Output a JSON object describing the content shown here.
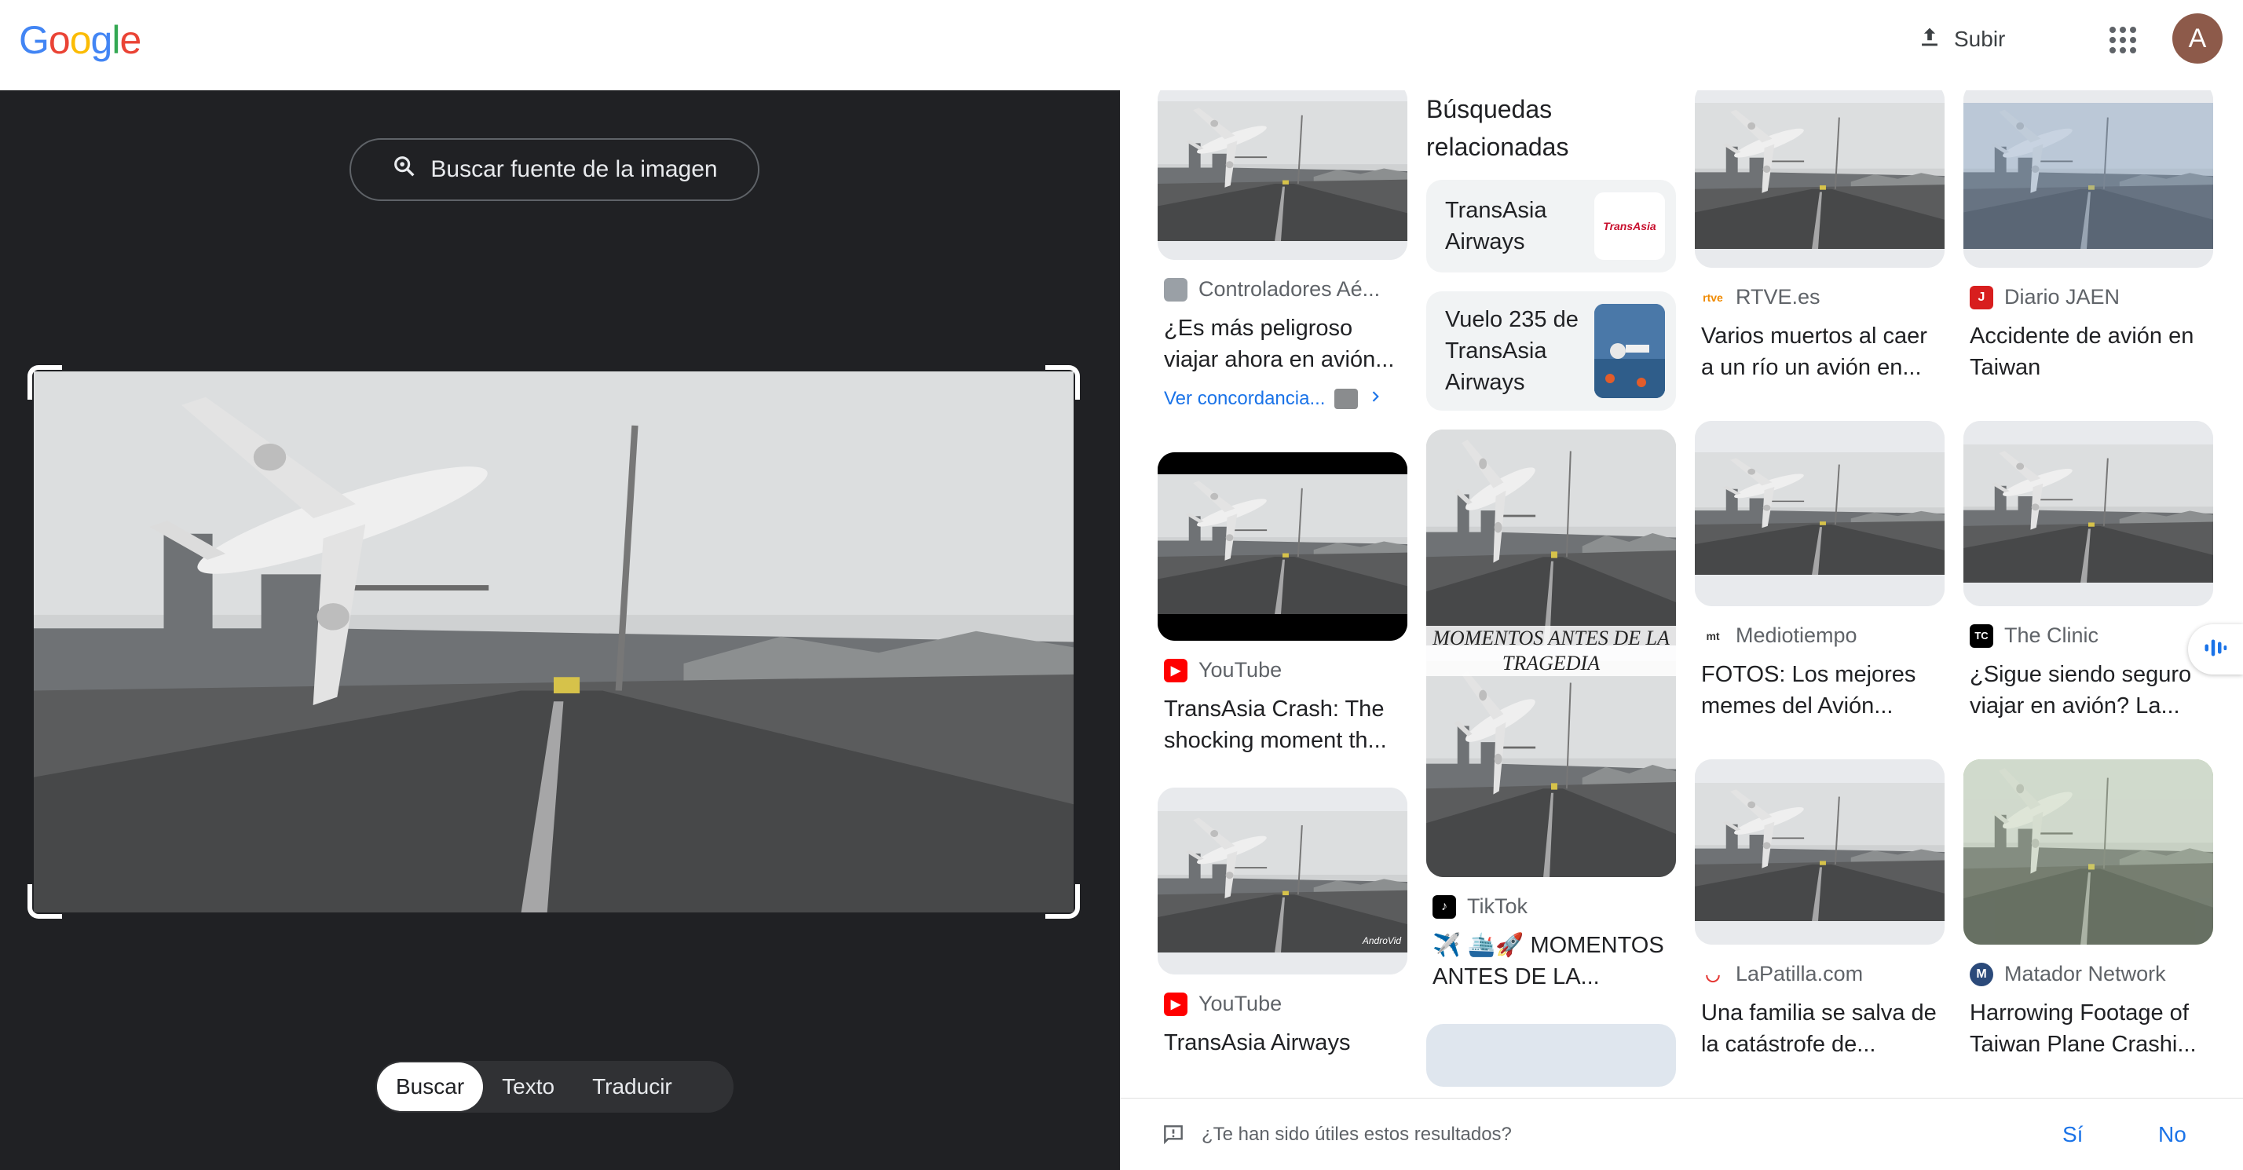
{
  "header": {
    "logo_letters": [
      "G",
      "o",
      "o",
      "g",
      "l",
      "e"
    ],
    "logo_colors": [
      "#4285F4",
      "#EA4335",
      "#FBBC05",
      "#4285F4",
      "#34A853",
      "#EA4335"
    ],
    "upload_label": "Subir",
    "avatar_letter": "A"
  },
  "left": {
    "source_button_label": "Buscar fuente de la imagen",
    "modes": [
      {
        "label": "Buscar",
        "active": true
      },
      {
        "label": "Texto",
        "active": false
      },
      {
        "label": "Traducir",
        "active": false
      }
    ]
  },
  "results": {
    "col1": [
      {
        "source": "Controladores Aé...",
        "title": "¿Es más peligroso viajar ahora en avión...",
        "favicon_color": "#9aa0a6",
        "favicon_text": "",
        "match_link": "Ver concordancia..."
      },
      {
        "source": "YouTube",
        "title": "TransAsia Crash: The shocking moment th...",
        "favicon_color": "#ff0000",
        "favicon_text": "▶"
      },
      {
        "source": "YouTube",
        "title": "TransAsia Airways",
        "favicon_color": "#ff0000",
        "favicon_text": "▶",
        "thumb_watermark": "AndroVid"
      }
    ],
    "col2": {
      "related_heading": "Búsquedas relacionadas",
      "chips": [
        {
          "label": "TransAsia Airways",
          "logo_text": "TransAsia"
        },
        {
          "label": "Vuelo 235 de TransAsia Airways"
        }
      ],
      "item": {
        "source": "TikTok",
        "title": "✈️ 🛳️🚀 MOMENTOS ANTES DE LA...",
        "favicon_color": "#000000",
        "favicon_text": "♪",
        "overlay_text": "MOMENTOS ANTES DE LA TRAGEDIA"
      }
    },
    "col3": [
      {
        "source": "RTVE.es",
        "title": "Varios muertos al caer a un río un avión en...",
        "favicon_color": "#ffffff",
        "favicon_text": "rtve"
      },
      {
        "source": "Mediotiempo",
        "title": "FOTOS: Los mejores memes del Avión...",
        "favicon_color": "#ffffff",
        "favicon_text": "mt"
      },
      {
        "source": "LaPatilla.com",
        "title": "Una familia se salva de la catástrofe de...",
        "favicon_color": "#ffffff",
        "favicon_text": "◡"
      }
    ],
    "col4": [
      {
        "source": "Diario JAEN",
        "title": "Accidente de avión en Taiwan",
        "favicon_color": "#d81e1e",
        "favicon_text": "J"
      },
      {
        "source": "The Clinic",
        "title": "¿Sigue siendo seguro viajar en avión? La...",
        "favicon_color": "#000000",
        "favicon_text": "TC"
      },
      {
        "source": "Matador Network",
        "title": "Harrowing Footage of Taiwan Plane Crashi...",
        "favicon_color": "#2b4a7a",
        "favicon_text": "M"
      }
    ]
  },
  "feedback": {
    "question": "¿Te han sido útiles estos resultados?",
    "yes": "Sí",
    "no": "No"
  }
}
